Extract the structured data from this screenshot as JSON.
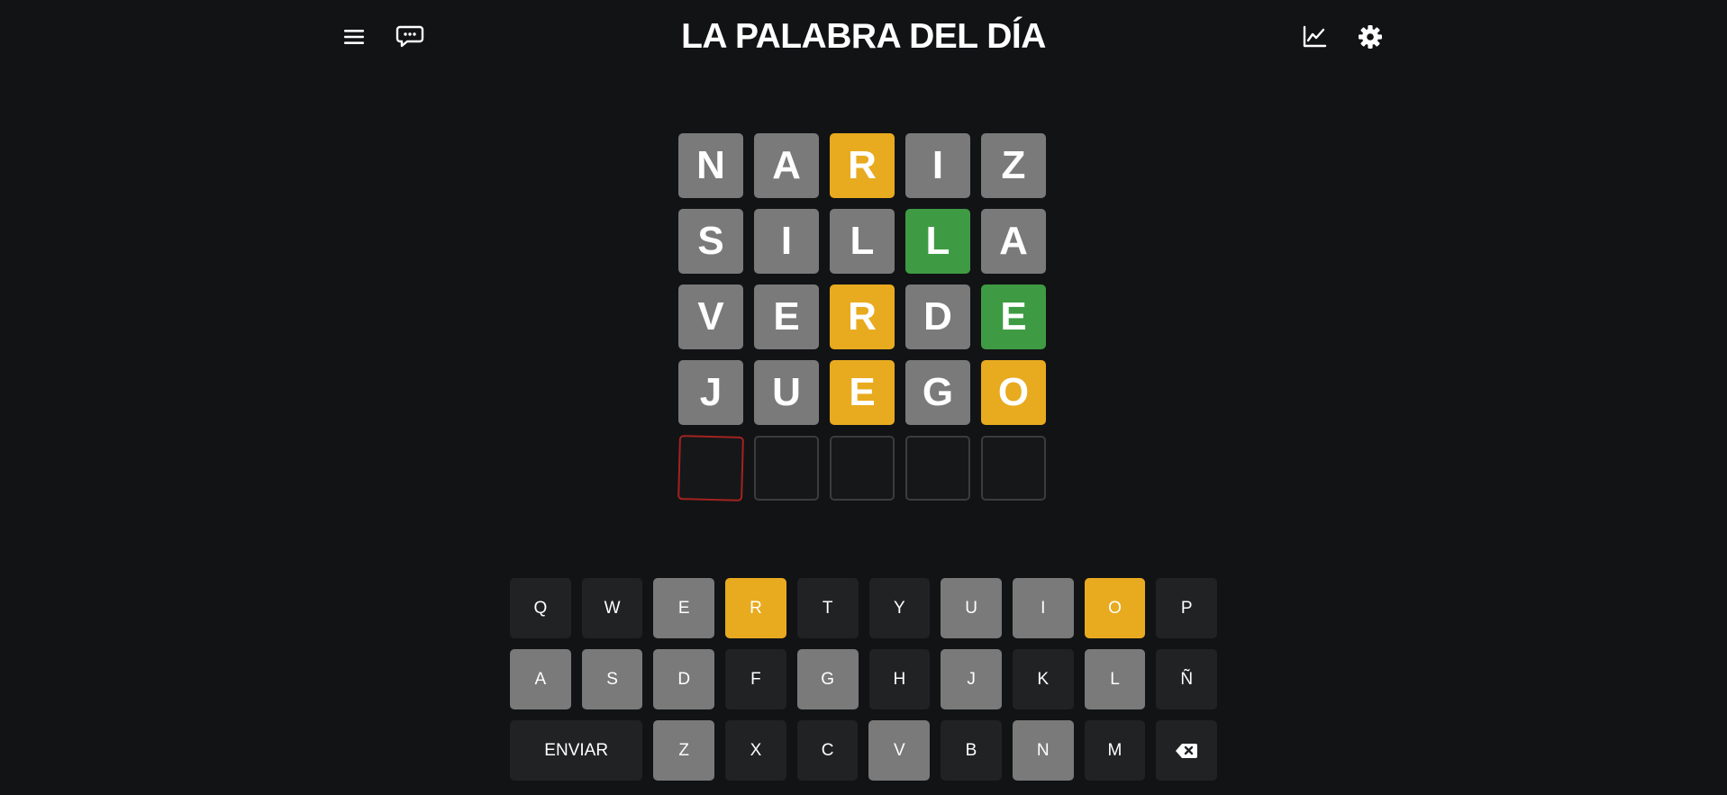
{
  "header": {
    "title": "LA PALABRA DEL DÍA",
    "left_icons": [
      "menu-icon",
      "chat-icon"
    ],
    "right_icons": [
      "stats-icon",
      "gear-icon"
    ]
  },
  "colors": {
    "absent": "#7a7a7a",
    "present": "#e8ab1f",
    "correct": "#3f9b43",
    "key_default": "#212224",
    "active_border": "#a3231f",
    "background": "#121315"
  },
  "board": [
    [
      {
        "l": "N",
        "s": "absent"
      },
      {
        "l": "A",
        "s": "absent"
      },
      {
        "l": "R",
        "s": "present"
      },
      {
        "l": "I",
        "s": "absent"
      },
      {
        "l": "Z",
        "s": "absent"
      }
    ],
    [
      {
        "l": "S",
        "s": "absent"
      },
      {
        "l": "I",
        "s": "absent"
      },
      {
        "l": "L",
        "s": "absent"
      },
      {
        "l": "L",
        "s": "correct"
      },
      {
        "l": "A",
        "s": "absent"
      }
    ],
    [
      {
        "l": "V",
        "s": "absent"
      },
      {
        "l": "E",
        "s": "absent"
      },
      {
        "l": "R",
        "s": "present"
      },
      {
        "l": "D",
        "s": "absent"
      },
      {
        "l": "E",
        "s": "correct"
      }
    ],
    [
      {
        "l": "J",
        "s": "absent"
      },
      {
        "l": "U",
        "s": "absent"
      },
      {
        "l": "E",
        "s": "present"
      },
      {
        "l": "G",
        "s": "absent"
      },
      {
        "l": "O",
        "s": "present"
      }
    ],
    [
      {
        "l": "",
        "s": "empty active"
      },
      {
        "l": "",
        "s": "empty"
      },
      {
        "l": "",
        "s": "empty"
      },
      {
        "l": "",
        "s": "empty"
      },
      {
        "l": "",
        "s": "empty"
      }
    ]
  ],
  "keyboard": [
    [
      {
        "k": "Q",
        "s": ""
      },
      {
        "k": "W",
        "s": ""
      },
      {
        "k": "E",
        "s": "absent"
      },
      {
        "k": "R",
        "s": "present"
      },
      {
        "k": "T",
        "s": ""
      },
      {
        "k": "Y",
        "s": ""
      },
      {
        "k": "U",
        "s": "absent"
      },
      {
        "k": "I",
        "s": "absent"
      },
      {
        "k": "O",
        "s": "present"
      },
      {
        "k": "P",
        "s": ""
      }
    ],
    [
      {
        "k": "A",
        "s": "absent"
      },
      {
        "k": "S",
        "s": "absent"
      },
      {
        "k": "D",
        "s": "absent"
      },
      {
        "k": "F",
        "s": ""
      },
      {
        "k": "G",
        "s": "absent"
      },
      {
        "k": "H",
        "s": ""
      },
      {
        "k": "J",
        "s": "absent"
      },
      {
        "k": "K",
        "s": ""
      },
      {
        "k": "L",
        "s": "absent"
      },
      {
        "k": "Ñ",
        "s": ""
      }
    ],
    [
      {
        "k": "ENVIAR",
        "s": "",
        "wide": true
      },
      {
        "k": "Z",
        "s": "absent"
      },
      {
        "k": "X",
        "s": ""
      },
      {
        "k": "C",
        "s": ""
      },
      {
        "k": "V",
        "s": "absent"
      },
      {
        "k": "B",
        "s": ""
      },
      {
        "k": "N",
        "s": "absent"
      },
      {
        "k": "M",
        "s": ""
      },
      {
        "k": "",
        "s": "",
        "icon": "backspace-icon"
      }
    ]
  ]
}
